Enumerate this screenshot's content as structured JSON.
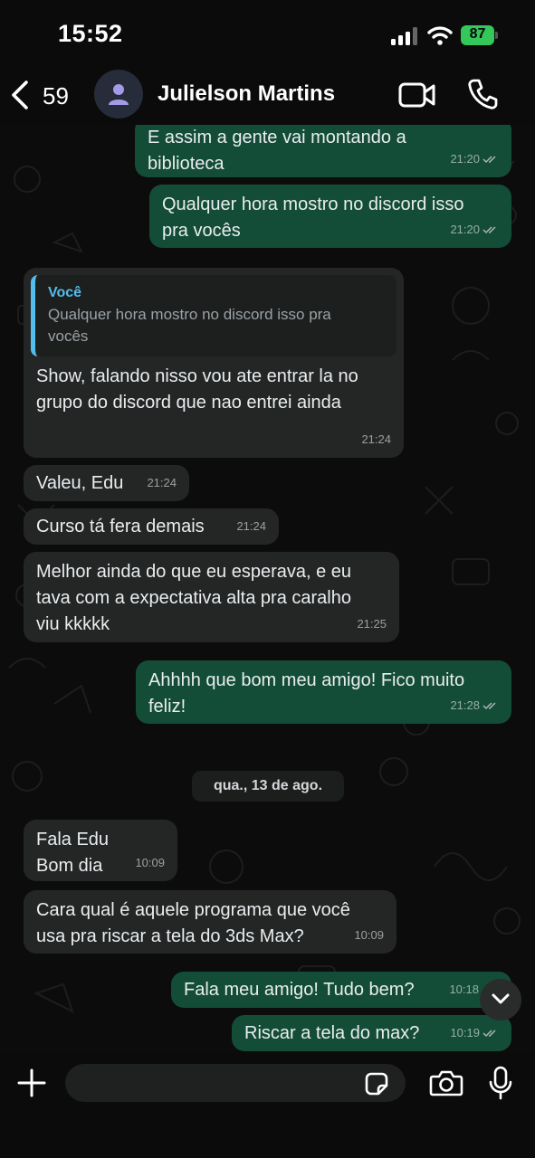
{
  "status_bar": {
    "time": "15:52",
    "battery": "87"
  },
  "header": {
    "back_count": "59",
    "contact_name": "Julielson Martins",
    "icons": [
      "back-chevron-icon",
      "person-icon",
      "video-call-icon",
      "phone-icon"
    ]
  },
  "messages": [
    {
      "id": "m1",
      "dir": "out",
      "text": "E assim a gente vai montando a\nbiblioteca",
      "time": "21:20",
      "status": "read"
    },
    {
      "id": "m2",
      "dir": "out",
      "text": "Qualquer hora mostro no discord isso\npra vocês",
      "time": "21:20",
      "status": "read"
    },
    {
      "id": "m3",
      "dir": "in",
      "quote_author": "Você",
      "quote_text": "Qualquer hora mostro no discord isso pra\nvocês",
      "text": "Show, falando nisso vou ate entrar la no\ngrupo do discord que nao entrei ainda",
      "time": "21:24"
    },
    {
      "id": "m4",
      "dir": "in",
      "text": "Valeu, Edu",
      "time": "21:24"
    },
    {
      "id": "m5",
      "dir": "in",
      "text": "Curso tá fera demais",
      "time": "21:24"
    },
    {
      "id": "m6",
      "dir": "in",
      "text": "Melhor ainda do que eu esperava, e eu\ntava com a expectativa alta pra caralho\nviu kkkkk",
      "time": "21:25"
    },
    {
      "id": "m7",
      "dir": "out",
      "text": "Ahhhh que bom meu amigo! Fico muito\nfeliz!",
      "time": "21:28",
      "status": "read"
    },
    {
      "id": "m8",
      "dir": "in",
      "text": "Fala Edu\nBom dia",
      "time": "10:09"
    },
    {
      "id": "m9",
      "dir": "in",
      "text": "Cara qual é aquele programa que você\nusa pra riscar a tela do 3ds Max?",
      "time": "10:09"
    },
    {
      "id": "m10",
      "dir": "out",
      "text": "Fala meu amigo! Tudo bem?",
      "time": "10:18",
      "status": "read"
    },
    {
      "id": "m11",
      "dir": "out",
      "text": "Riscar a tela do max?",
      "time": "10:19",
      "status": "read"
    }
  ],
  "date_separator": "qua., 13 de ago.",
  "composer": {
    "placeholder": "",
    "icons": [
      "plus-icon",
      "sticker-icon",
      "camera-icon",
      "microphone-icon"
    ]
  },
  "colors": {
    "incoming_bubble": "#242626",
    "outgoing_bubble": "#144d37",
    "quote_accent": "#53bdeb",
    "battery": "#34c759"
  }
}
